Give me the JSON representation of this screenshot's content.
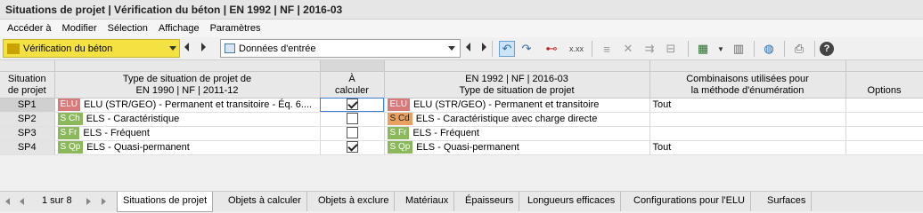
{
  "window": {
    "title": "Situations de projet | Vérification du béton | EN 1992 | NF | 2016-03"
  },
  "menu": {
    "items": [
      "Accéder à",
      "Modifier",
      "Sélection",
      "Affichage",
      "Paramètres"
    ]
  },
  "toolbar": {
    "module_combo": "Vérification du béton",
    "view_combo": "Données d'entrée"
  },
  "table": {
    "headers": {
      "situation": "Situation\nde projet",
      "type_line1": "Type de situation de projet de",
      "type_line2": "EN 1990 | NF | 2011-12",
      "calc_line1": "À",
      "calc_line2": "calculer",
      "en_line1": "EN 1992 | NF | 2016-03",
      "en_line2": "Type de situation de projet",
      "comb_line1": "Combinaisons utilisées pour",
      "comb_line2": "la méthode d'énumération",
      "options": "Options"
    },
    "rows": [
      {
        "id": "SP1",
        "badge1": "ELU",
        "type1": "ELU (STR/GEO) - Permanent et transitoire - Éq. 6....",
        "calc": true,
        "badge2": "ELU",
        "type2": "ELU (STR/GEO) - Permanent et transitoire",
        "comb": "Tout",
        "options": ""
      },
      {
        "id": "SP2",
        "badge1": "S Ch",
        "type1": "ELS - Caractéristique",
        "calc": false,
        "badge2": "S Cd",
        "type2": "ELS - Caractéristique avec charge directe",
        "comb": "",
        "options": ""
      },
      {
        "id": "SP3",
        "badge1": "S Fr",
        "type1": "ELS - Fréquent",
        "calc": false,
        "badge2": "S Fr",
        "type2": "ELS - Fréquent",
        "comb": "",
        "options": ""
      },
      {
        "id": "SP4",
        "badge1": "S Qp",
        "type1": "ELS - Quasi-permanent",
        "calc": true,
        "badge2": "S Qp",
        "type2": "ELS - Quasi-permanent",
        "comb": "Tout",
        "options": ""
      }
    ]
  },
  "tabs": {
    "pager": "1 sur 8",
    "items": [
      "Situations de projet",
      "Objets à calculer",
      "Objets à exclure",
      "Matériaux",
      "Épaisseurs",
      "Longueurs efficaces",
      "Configurations pour l'ELU",
      "Surfaces"
    ],
    "active_index": 0
  },
  "colors": {
    "combo_yellow": "#f4e242",
    "badge_elu": "#d97a7a",
    "badge_els": "#8ab85a",
    "badge_scd": "#e8a060"
  }
}
